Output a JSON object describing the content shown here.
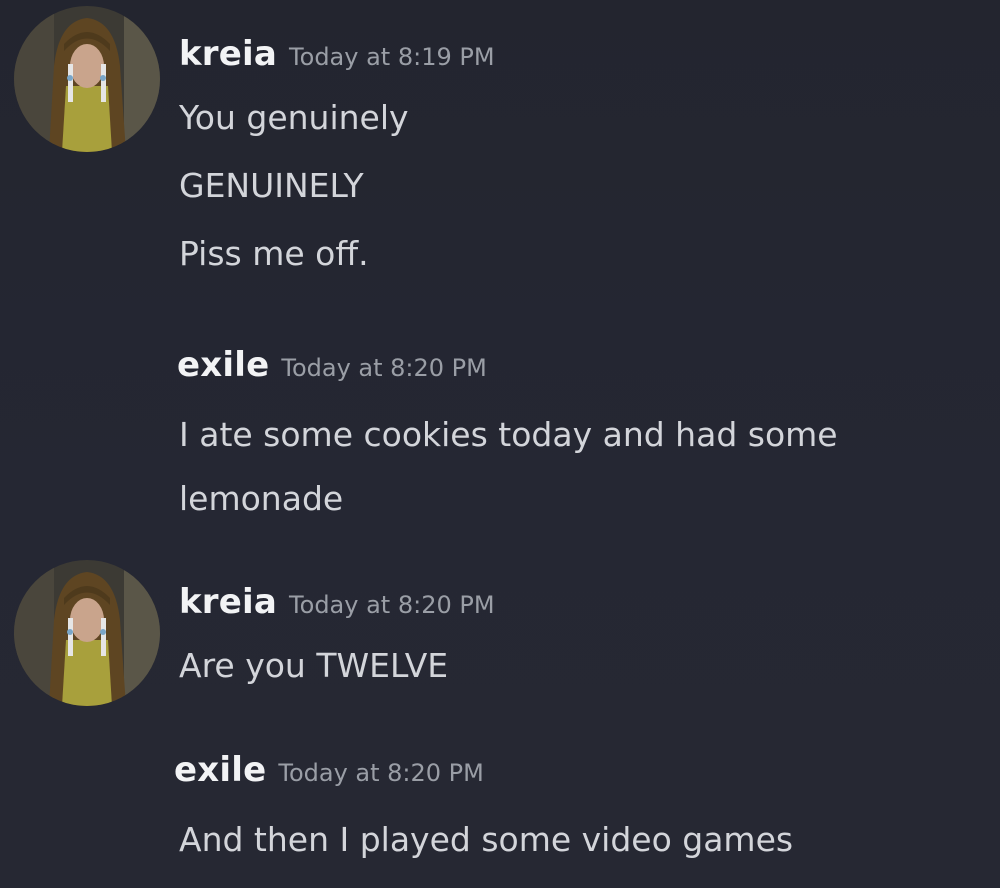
{
  "messages": [
    {
      "author": "kreia",
      "timestamp": "Today at 8:19 PM",
      "lines": [
        "You genuinely",
        "GENUINELY",
        "Piss me off."
      ]
    },
    {
      "author": "exile",
      "timestamp": "Today at 8:20 PM",
      "lines": [
        "I ate some cookies today and had some",
        "lemonade"
      ]
    },
    {
      "author": "kreia",
      "timestamp": "Today at 8:20 PM",
      "lines": [
        "Are you TWELVE"
      ]
    },
    {
      "author": "exile",
      "timestamp": "Today at 8:20 PM",
      "lines": [
        "And then I played some video games"
      ]
    }
  ],
  "colors": {
    "background": "#242632",
    "author": "#f2f3f5",
    "timestamp": "#9a9ea6",
    "message_text": "#d3d5da"
  }
}
